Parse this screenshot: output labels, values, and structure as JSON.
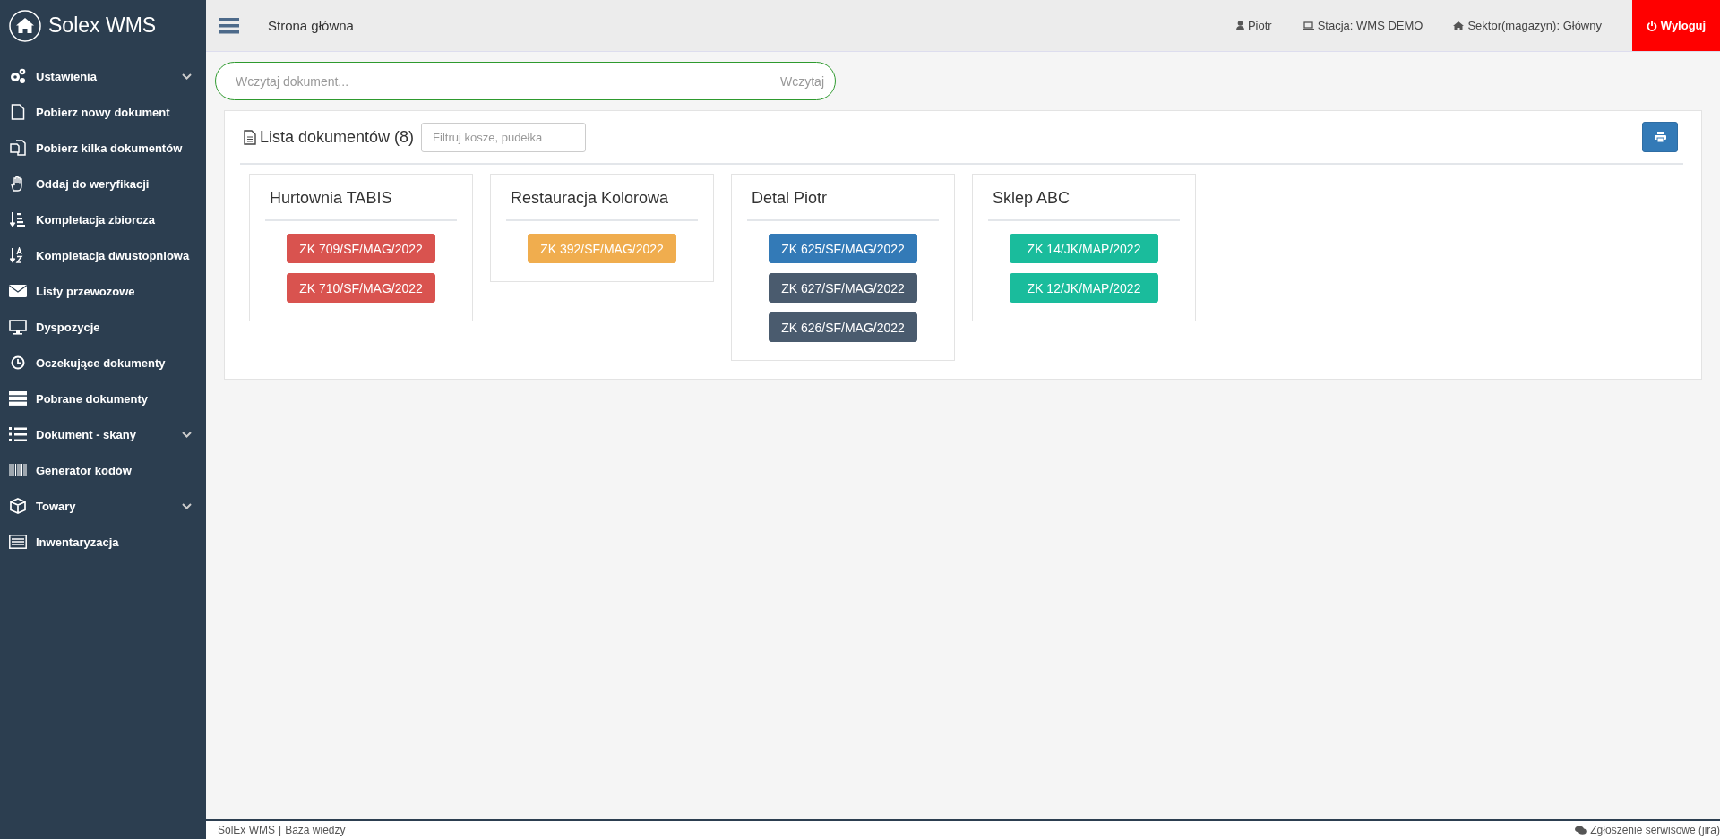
{
  "sidebar": {
    "logo": "Solex WMS",
    "items": [
      {
        "label": "Ustawienia",
        "expandable": true
      },
      {
        "label": "Pobierz nowy dokument",
        "expandable": false
      },
      {
        "label": "Pobierz kilka dokumentów",
        "expandable": false
      },
      {
        "label": "Oddaj do weryfikacji",
        "expandable": false
      },
      {
        "label": "Kompletacja zbiorcza",
        "expandable": false
      },
      {
        "label": "Kompletacja dwustopniowa",
        "expandable": false
      },
      {
        "label": "Listy przewozowe",
        "expandable": false
      },
      {
        "label": "Dyspozycje",
        "expandable": false
      },
      {
        "label": "Oczekujące dokumenty",
        "expandable": false
      },
      {
        "label": "Pobrane dokumenty",
        "expandable": false
      },
      {
        "label": "Dokument - skany",
        "expandable": true
      },
      {
        "label": "Generator kodów",
        "expandable": false
      },
      {
        "label": "Towary",
        "expandable": true
      },
      {
        "label": "Inwentaryzacja",
        "expandable": false
      }
    ]
  },
  "topbar": {
    "title": "Strona główna",
    "user": "Piotr",
    "station": "Stacja: WMS DEMO",
    "sector": "Sektor(magazyn): Główny",
    "logout": "Wyloguj"
  },
  "scan": {
    "placeholder": "Wczytaj dokument...",
    "button": "Wczytaj"
  },
  "documents": {
    "title": "Lista dokumentów (8)",
    "filter_placeholder": "Filtruj kosze, pudełka",
    "groups": [
      {
        "name": "Hurtownia TABIS",
        "docs": [
          {
            "label": "ZK 709/SF/MAG/2022",
            "color": "#d9534f"
          },
          {
            "label": "ZK 710/SF/MAG/2022",
            "color": "#d9534f"
          }
        ]
      },
      {
        "name": "Restauracja Kolorowa",
        "docs": [
          {
            "label": "ZK 392/SF/MAG/2022",
            "color": "#f0ad4e"
          }
        ]
      },
      {
        "name": "Detal Piotr",
        "docs": [
          {
            "label": "ZK 625/SF/MAG/2022",
            "color": "#337ab7"
          },
          {
            "label": "ZK 627/SF/MAG/2022",
            "color": "#4a5b6e"
          },
          {
            "label": "ZK 626/SF/MAG/2022",
            "color": "#4a5b6e"
          }
        ]
      },
      {
        "name": "Sklep ABC",
        "docs": [
          {
            "label": "ZK 14/JK/MAP/2022",
            "color": "#1abc9c"
          },
          {
            "label": "ZK 12/JK/MAP/2022",
            "color": "#1abc9c"
          }
        ]
      }
    ]
  },
  "footer": {
    "brand": "SolEx WMS",
    "separator": "|",
    "link": "Baza wiedzy",
    "support": "Zgłoszenie serwisowe (jira)"
  }
}
